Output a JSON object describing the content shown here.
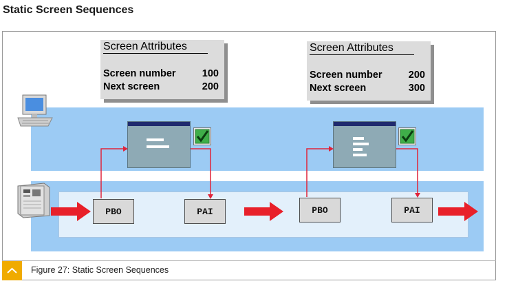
{
  "page_title": "Static Screen Sequences",
  "attributes": [
    {
      "heading": "Screen Attributes",
      "rows": [
        {
          "label": "Screen number",
          "value": "100"
        },
        {
          "label": "Next screen",
          "value": "200"
        }
      ]
    },
    {
      "heading": "Screen Attributes",
      "rows": [
        {
          "label": "Screen number",
          "value": "200"
        },
        {
          "label": "Next screen",
          "value": "300"
        }
      ]
    }
  ],
  "modules": {
    "pbo_1": "PBO",
    "pai_1": "PAI",
    "pbo_2": "PBO",
    "pai_2": "PAI"
  },
  "caption": {
    "text": "Figure 27: Static Screen Sequences",
    "icon": "chevron-up-icon"
  },
  "colors": {
    "band": "#9ccbf4",
    "arrow_red": "#e8202a",
    "connector": "#e0243a",
    "caption_accent": "#f0ab00"
  }
}
